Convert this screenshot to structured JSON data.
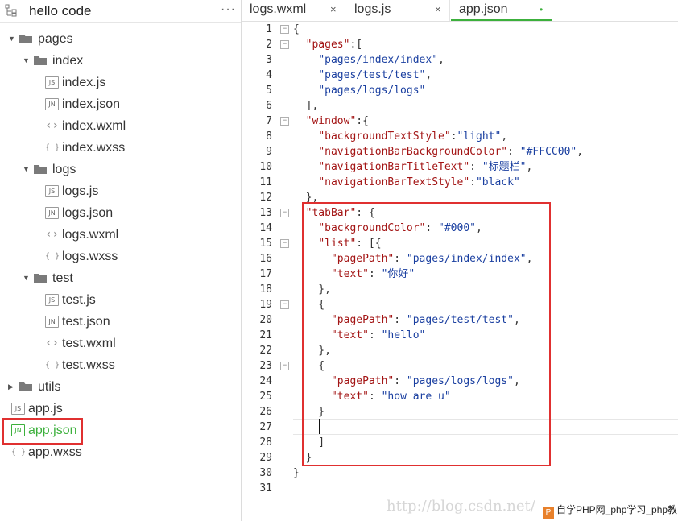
{
  "sidebar": {
    "title": "hello code",
    "more_icon": "more-icon",
    "tree": [
      {
        "id": "pages",
        "label": "pages",
        "kind": "folder",
        "expanded": true,
        "depth": 0
      },
      {
        "id": "index",
        "label": "index",
        "kind": "folder",
        "expanded": true,
        "depth": 1
      },
      {
        "id": "index-js",
        "label": "index.js",
        "kind": "js",
        "badge": "JS",
        "depth": 2
      },
      {
        "id": "index-json",
        "label": "index.json",
        "kind": "json",
        "badge": "JN",
        "depth": 2
      },
      {
        "id": "index-wxml",
        "label": "index.wxml",
        "kind": "wxml",
        "badge": "<>",
        "depth": 2
      },
      {
        "id": "index-wxss",
        "label": "index.wxss",
        "kind": "wxss",
        "badge": "{}",
        "depth": 2
      },
      {
        "id": "logs",
        "label": "logs",
        "kind": "folder",
        "expanded": true,
        "depth": 1
      },
      {
        "id": "logs-js",
        "label": "logs.js",
        "kind": "js",
        "badge": "JS",
        "depth": 2
      },
      {
        "id": "logs-json",
        "label": "logs.json",
        "kind": "json",
        "badge": "JN",
        "depth": 2
      },
      {
        "id": "logs-wxml",
        "label": "logs.wxml",
        "kind": "wxml",
        "badge": "<>",
        "depth": 2
      },
      {
        "id": "logs-wxss",
        "label": "logs.wxss",
        "kind": "wxss",
        "badge": "{}",
        "depth": 2
      },
      {
        "id": "test",
        "label": "test",
        "kind": "folder",
        "expanded": true,
        "depth": 1
      },
      {
        "id": "test-js",
        "label": "test.js",
        "kind": "js",
        "badge": "JS",
        "depth": 2
      },
      {
        "id": "test-json",
        "label": "test.json",
        "kind": "json",
        "badge": "JN",
        "depth": 2
      },
      {
        "id": "test-wxml",
        "label": "test.wxml",
        "kind": "wxml",
        "badge": "<>",
        "depth": 2
      },
      {
        "id": "test-wxss",
        "label": "test.wxss",
        "kind": "wxss",
        "badge": "{}",
        "depth": 2
      },
      {
        "id": "utils",
        "label": "utils",
        "kind": "folder",
        "expanded": false,
        "depth": 0
      },
      {
        "id": "app-js",
        "label": "app.js",
        "kind": "js",
        "badge": "JS",
        "depth": 0
      },
      {
        "id": "app-json",
        "label": "app.json",
        "kind": "json",
        "badge": "JN",
        "depth": 0,
        "active": true
      },
      {
        "id": "app-wxss",
        "label": "app.wxss",
        "kind": "wxss",
        "badge": "{}",
        "depth": 0
      }
    ]
  },
  "tabs": [
    {
      "label": "logs.wxml",
      "close": "×",
      "active": false
    },
    {
      "label": "logs.js",
      "close": "×",
      "active": false
    },
    {
      "label": "app.json",
      "close": "•",
      "active": true
    }
  ],
  "editor": {
    "file": "app.json",
    "lines": [
      {
        "n": "1",
        "fold": true,
        "text": "{"
      },
      {
        "n": "2",
        "fold": true,
        "text": "  \"pages\":["
      },
      {
        "n": "3",
        "fold": false,
        "text": "    \"pages/index/index\","
      },
      {
        "n": "4",
        "fold": false,
        "text": "    \"pages/test/test\","
      },
      {
        "n": "5",
        "fold": false,
        "text": "    \"pages/logs/logs\""
      },
      {
        "n": "6",
        "fold": false,
        "text": "  ],"
      },
      {
        "n": "7",
        "fold": true,
        "text": "  \"window\":{"
      },
      {
        "n": "8",
        "fold": false,
        "text": "    \"backgroundTextStyle\":\"light\","
      },
      {
        "n": "9",
        "fold": false,
        "text": "    \"navigationBarBackgroundColor\": \"#FFCC00\","
      },
      {
        "n": "10",
        "fold": false,
        "text": "    \"navigationBarTitleText\": \"标题栏\","
      },
      {
        "n": "11",
        "fold": false,
        "text": "    \"navigationBarTextStyle\":\"black\""
      },
      {
        "n": "12",
        "fold": false,
        "text": "  },"
      },
      {
        "n": "13",
        "fold": true,
        "text": "  \"tabBar\": {"
      },
      {
        "n": "14",
        "fold": false,
        "text": "    \"backgroundColor\": \"#000\","
      },
      {
        "n": "15",
        "fold": true,
        "text": "    \"list\": [{"
      },
      {
        "n": "16",
        "fold": false,
        "text": "      \"pagePath\": \"pages/index/index\","
      },
      {
        "n": "17",
        "fold": false,
        "text": "      \"text\": \"你好\""
      },
      {
        "n": "18",
        "fold": false,
        "text": "    },"
      },
      {
        "n": "19",
        "fold": true,
        "text": "    {"
      },
      {
        "n": "20",
        "fold": false,
        "text": "      \"pagePath\": \"pages/test/test\","
      },
      {
        "n": "21",
        "fold": false,
        "text": "      \"text\": \"hello\""
      },
      {
        "n": "22",
        "fold": false,
        "text": "    },"
      },
      {
        "n": "23",
        "fold": true,
        "text": "    {"
      },
      {
        "n": "24",
        "fold": false,
        "text": "      \"pagePath\": \"pages/logs/logs\","
      },
      {
        "n": "25",
        "fold": false,
        "text": "      \"text\": \"how are u\""
      },
      {
        "n": "26",
        "fold": false,
        "text": "    }"
      },
      {
        "n": "27",
        "fold": false,
        "text": ""
      },
      {
        "n": "28",
        "fold": false,
        "text": "    ]"
      },
      {
        "n": "29",
        "fold": false,
        "text": "  }"
      },
      {
        "n": "30",
        "fold": false,
        "text": "}"
      },
      {
        "n": "31",
        "fold": false,
        "text": ""
      }
    ],
    "cursor_line": "27"
  },
  "watermark": {
    "url": "http://blog.csdn.net/",
    "badge_text": "自学PHP网_php学习_php教",
    "badge_logo": "P"
  },
  "colors": {
    "accent": "#3cb03c",
    "highlight": "#e03030",
    "json_key": "#a31515",
    "json_string": "#1a3fa0"
  }
}
